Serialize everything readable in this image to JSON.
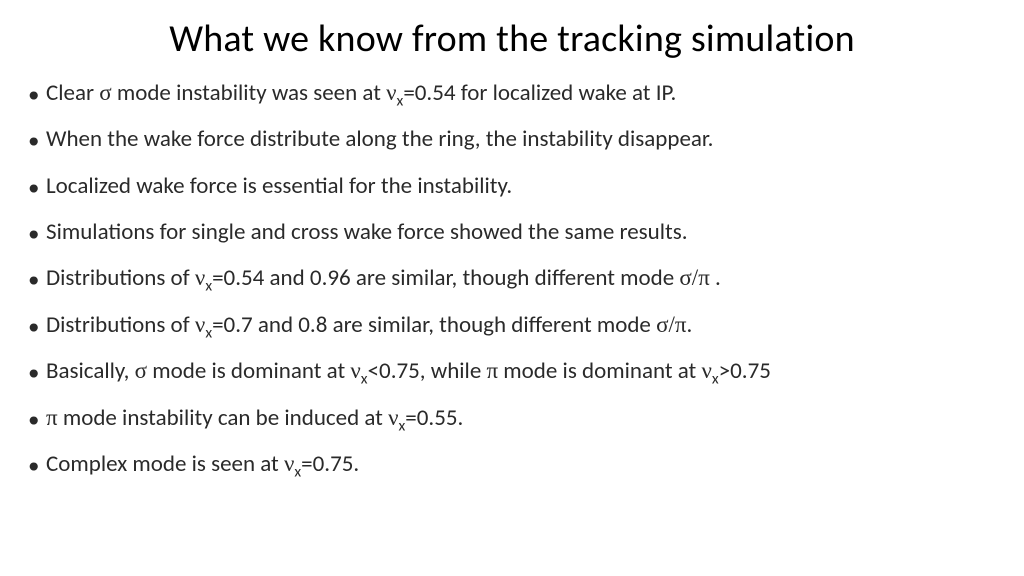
{
  "slide": {
    "title": "What we know from the tracking simulation",
    "bullets": [
      {
        "pre": "Clear ",
        "g1": "σ",
        "mid1": " mode instability was seen at ",
        "g2": "ν",
        "sub": "x",
        "mid2": "=0.54 for localized wake at IP."
      },
      {
        "text": "When the wake force distribute along the ring, the instability disappear."
      },
      {
        "text": "Localized wake force is essential for the instability."
      },
      {
        "text": "Simulations for single and cross wake force showed the same results."
      },
      {
        "pre": "Distributions of ",
        "g2": "ν",
        "sub": "x",
        "mid2": "=0.54 and 0.96 are similar, though different mode ",
        "g3": "σ/π",
        "post": " ."
      },
      {
        "pre": "Distributions of ",
        "g2": "ν",
        "sub": "x",
        "mid2": "=0.7 and 0.8 are similar, though different mode ",
        "g3": "σ/π",
        "post": "."
      },
      {
        "pre": "Basically, ",
        "g1": "σ",
        "mid1": " mode is dominant at ",
        "g2": "ν",
        "sub": "x",
        "mid2": "<0.75, while ",
        "g3": "π",
        "mid3": " mode is dominant at ",
        "g4": "ν",
        "sub2": "x",
        "post": ">0.75"
      },
      {
        "g1": "π",
        "mid1": " mode instability can be induced at ",
        "g2": "ν",
        "sub": "x",
        "mid2": "=0.55."
      },
      {
        "pre": "Complex mode is seen at ",
        "g2": "ν",
        "sub": "x",
        "mid2": "=0.75."
      }
    ]
  }
}
